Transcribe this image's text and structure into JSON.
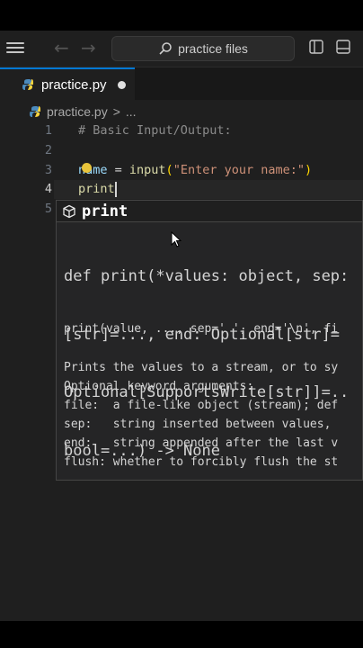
{
  "titlebar": {
    "search_text": "practice files",
    "icons": [
      "menu-icon",
      "back-arrow-icon",
      "forward-arrow-icon",
      "search-icon",
      "sidebar-layout-icon",
      "panel-layout-icon"
    ]
  },
  "tab": {
    "label": "practice.py",
    "modified": true
  },
  "breadcrumb": {
    "file": "practice.py",
    "separator": ">",
    "more": "..."
  },
  "editor": {
    "lines": [
      {
        "num": "1",
        "comment": "# Basic Input/Output:"
      },
      {
        "num": "2"
      },
      {
        "num": "3",
        "var": "name",
        "op": " = ",
        "fn": "input",
        "lparen": "(",
        "str": "\"Enter your name:\"",
        "rparen": ")"
      },
      {
        "num": "4",
        "fn": "print"
      },
      {
        "num": "5"
      }
    ]
  },
  "suggestion": {
    "label": "print",
    "kind_icon": "cube-icon"
  },
  "docs": {
    "signature": [
      "def print(*values: object, sep:",
      "[str]=..., end: Optional[str]=",
      "Optional[SupportsWrite[str]]=..",
      "bool=...) -> None"
    ],
    "usage": "print(value, ..., sep=' ', end='\\n', fi",
    "description": [
      "Prints the values to a stream, or to sy",
      "Optional keyword arguments:",
      "file:  a file-like object (stream); def",
      "sep:   string inserted between values,",
      "end:   string appended after the last v",
      "flush: whether to forcibly flush the st"
    ]
  },
  "colors": {
    "accent": "#0078d4",
    "editor_bg": "#1f1f1f",
    "string": "#ce9178",
    "function": "#dcdcaa",
    "variable": "#9cdcfe"
  }
}
